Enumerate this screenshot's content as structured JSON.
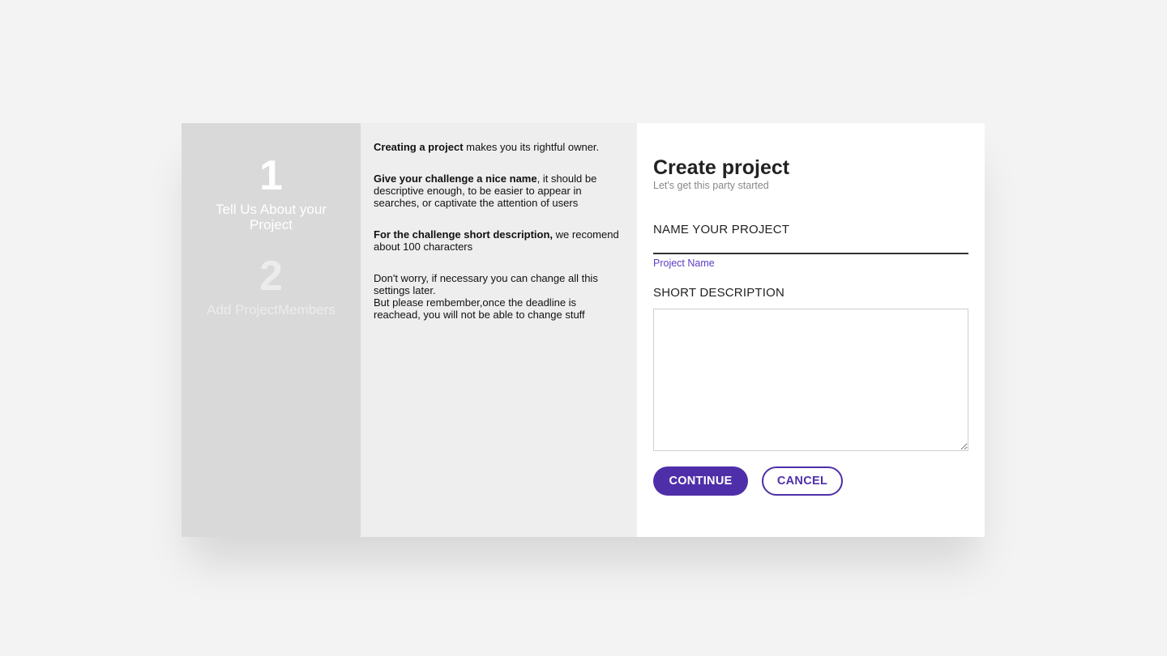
{
  "steps": [
    {
      "number": "1",
      "label": "Tell Us About your Project",
      "state": "active"
    },
    {
      "number": "2",
      "label": "Add ProjectMembers",
      "state": "inactive"
    }
  ],
  "info": {
    "p1": {
      "bold": "Creating a project",
      "text": " makes you its rightful owner."
    },
    "p2": {
      "bold": "Give your challenge a nice name",
      "text": ", it should be descriptive enough, to be easier to appear in searches, or captivate the attention of users"
    },
    "p3": {
      "bold": "For the challenge short description,",
      "text": " we recomend about 100 characters"
    },
    "p4": {
      "line1": "Don't worry, if necessary you can change all this settings later.",
      "line2": "But please rembember,once the deadline is reachead, you will not be able to change stuff"
    }
  },
  "form": {
    "title": "Create project",
    "subtitle": "Let's get this party started",
    "name_label": "NAME YOUR PROJECT",
    "name_value": "",
    "name_hint": "Project Name",
    "description_label": "SHORT DESCRIPTION",
    "description_value": "",
    "continue_label": "CONTINUE",
    "cancel_label": "CANCEL"
  },
  "colors": {
    "accent": "#4f2fa9",
    "page_background": "#f3f3f3",
    "steps_panel": "#d9d9d9",
    "info_panel": "#eeeeee"
  }
}
